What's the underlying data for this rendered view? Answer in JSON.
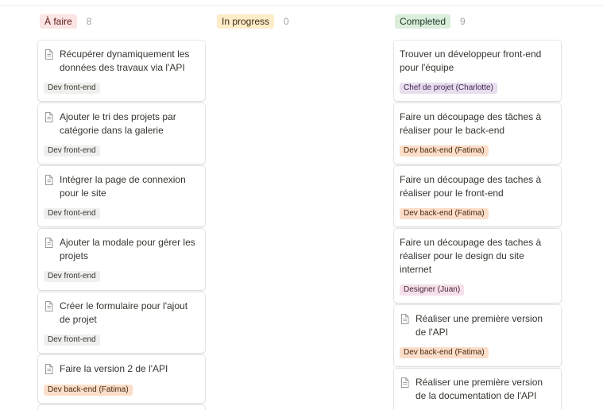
{
  "colors": {
    "status_todo_bg": "#fbe4e4",
    "status_inprogress_bg": "#fdecc8",
    "status_done_bg": "#dbeddb",
    "tag_front_bg": "#efefed",
    "tag_back_bg": "#fadec9",
    "tag_pm_bg": "#e8deee",
    "tag_design_bg": "#f5e0e9"
  },
  "columns": [
    {
      "status": "À faire",
      "count": "8",
      "cards": [
        {
          "title": "Récupérer dynamiquement les données des travaux via l'API",
          "icon": "page-icon",
          "tag": "Dev front-end"
        },
        {
          "title": "Ajouter le tri des projets par catégorie dans la galerie",
          "icon": "page-icon",
          "tag": "Dev front-end"
        },
        {
          "title": "Intégrer la page de connexion pour le site",
          "icon": "page-icon",
          "tag": "Dev front-end"
        },
        {
          "title": "Ajouter la modale pour gérer les projets",
          "icon": "page-icon",
          "tag": "Dev front-end"
        },
        {
          "title": "Créer le formulaire pour l'ajout de projet",
          "icon": "page-icon",
          "tag": "Dev front-end"
        },
        {
          "title": "Faire la version 2 de l'API",
          "icon": "page-icon",
          "tag": "Dev back-end (Fatima)"
        }
      ]
    },
    {
      "status": "In progress",
      "count": "0",
      "cards": []
    },
    {
      "status": "Completed",
      "count": "9",
      "cards": [
        {
          "title": "Trouver un développeur front-end pour l'équipe",
          "icon": "",
          "tag": "Chef de projet (Charlotte)"
        },
        {
          "title": "Faire un découpage des tâches à réaliser pour le back-end",
          "icon": "",
          "tag": "Dev back-end (Fatima)"
        },
        {
          "title": "Faire un découpage des taches à réaliser pour le front-end",
          "icon": "",
          "tag": "Dev back-end (Fatima)"
        },
        {
          "title": "Faire un découpage des taches à réaliser pour le design du site internet",
          "icon": "",
          "tag": "Designer (Juan)"
        },
        {
          "title": "Réaliser une première version de l'API",
          "icon": "page-icon",
          "tag": "Dev back-end (Fatima)"
        },
        {
          "title": "Réaliser une première version de la documentation de l'API",
          "icon": "page-icon",
          "tag": ""
        }
      ]
    }
  ]
}
